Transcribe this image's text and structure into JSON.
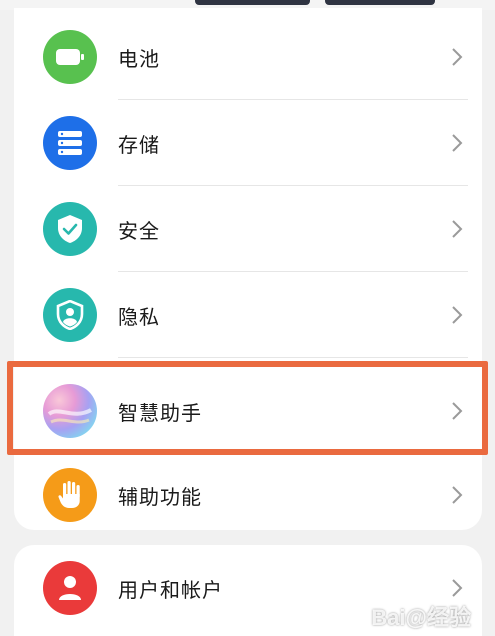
{
  "colors": {
    "battery": "#58c14f",
    "storage": "#1e6fe8",
    "security": "#27b8ad",
    "privacy": "#27b8ad",
    "accessibility": "#f59b18",
    "users": "#ea3a3a",
    "highlight": "#ea6a3f"
  },
  "settings": {
    "items": [
      {
        "label": "电池",
        "icon": "battery-icon"
      },
      {
        "label": "存储",
        "icon": "storage-icon"
      },
      {
        "label": "安全",
        "icon": "shield-check-icon"
      },
      {
        "label": "隐私",
        "icon": "privacy-shield-icon"
      },
      {
        "label": "智慧助手",
        "icon": "smart-assistant-icon"
      },
      {
        "label": "辅助功能",
        "icon": "hand-icon"
      },
      {
        "label": "用户和帐户",
        "icon": "user-icon"
      }
    ]
  },
  "watermark": "Bai@经验"
}
